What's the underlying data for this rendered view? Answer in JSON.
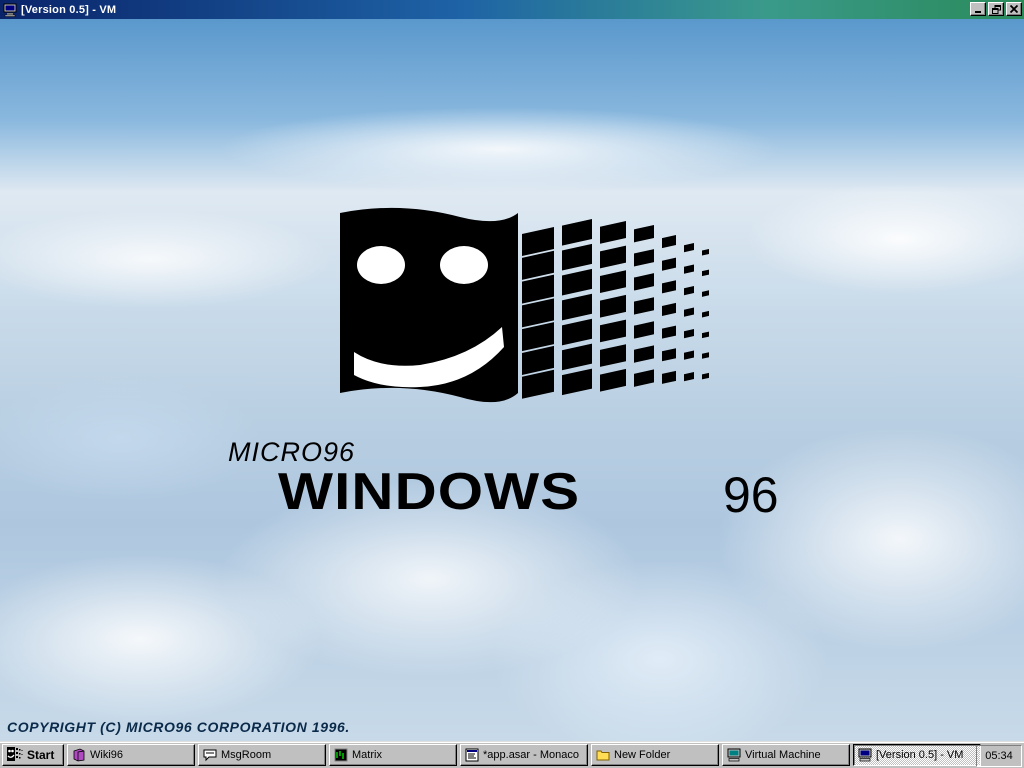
{
  "window": {
    "title": "[Version 0.5] - VM",
    "controls": [
      "minimize-icon",
      "restore-icon",
      "close-icon"
    ]
  },
  "desktop": {
    "logo": {
      "brand_line1": "MICRO96",
      "brand_line2": "WINDOWS",
      "brand_line3": "96"
    },
    "copyright": "COPYRIGHT (C) MICRO96 CORPORATION 1996."
  },
  "taskbar": {
    "start_label": "Start",
    "tasks": [
      {
        "label": "Wiki96",
        "icon": "book-icon",
        "active": false
      },
      {
        "label": "MsgRoom",
        "icon": "chat-icon",
        "active": false
      },
      {
        "label": "Matrix",
        "icon": "terminal-icon",
        "active": false
      },
      {
        "label": "*app.asar - Monaco",
        "icon": "editor-icon",
        "active": false
      },
      {
        "label": "New Folder",
        "icon": "folder-icon",
        "active": false
      },
      {
        "label": "Virtual Machine",
        "icon": "computer-icon",
        "active": false
      },
      {
        "label": "[Version 0.5] - VM",
        "icon": "computer-icon",
        "active": true
      }
    ],
    "clock": "05:34"
  },
  "colors": {
    "face": "#c0c0c0",
    "title_start": "#0a246a",
    "title_end": "#2a8a5a"
  }
}
